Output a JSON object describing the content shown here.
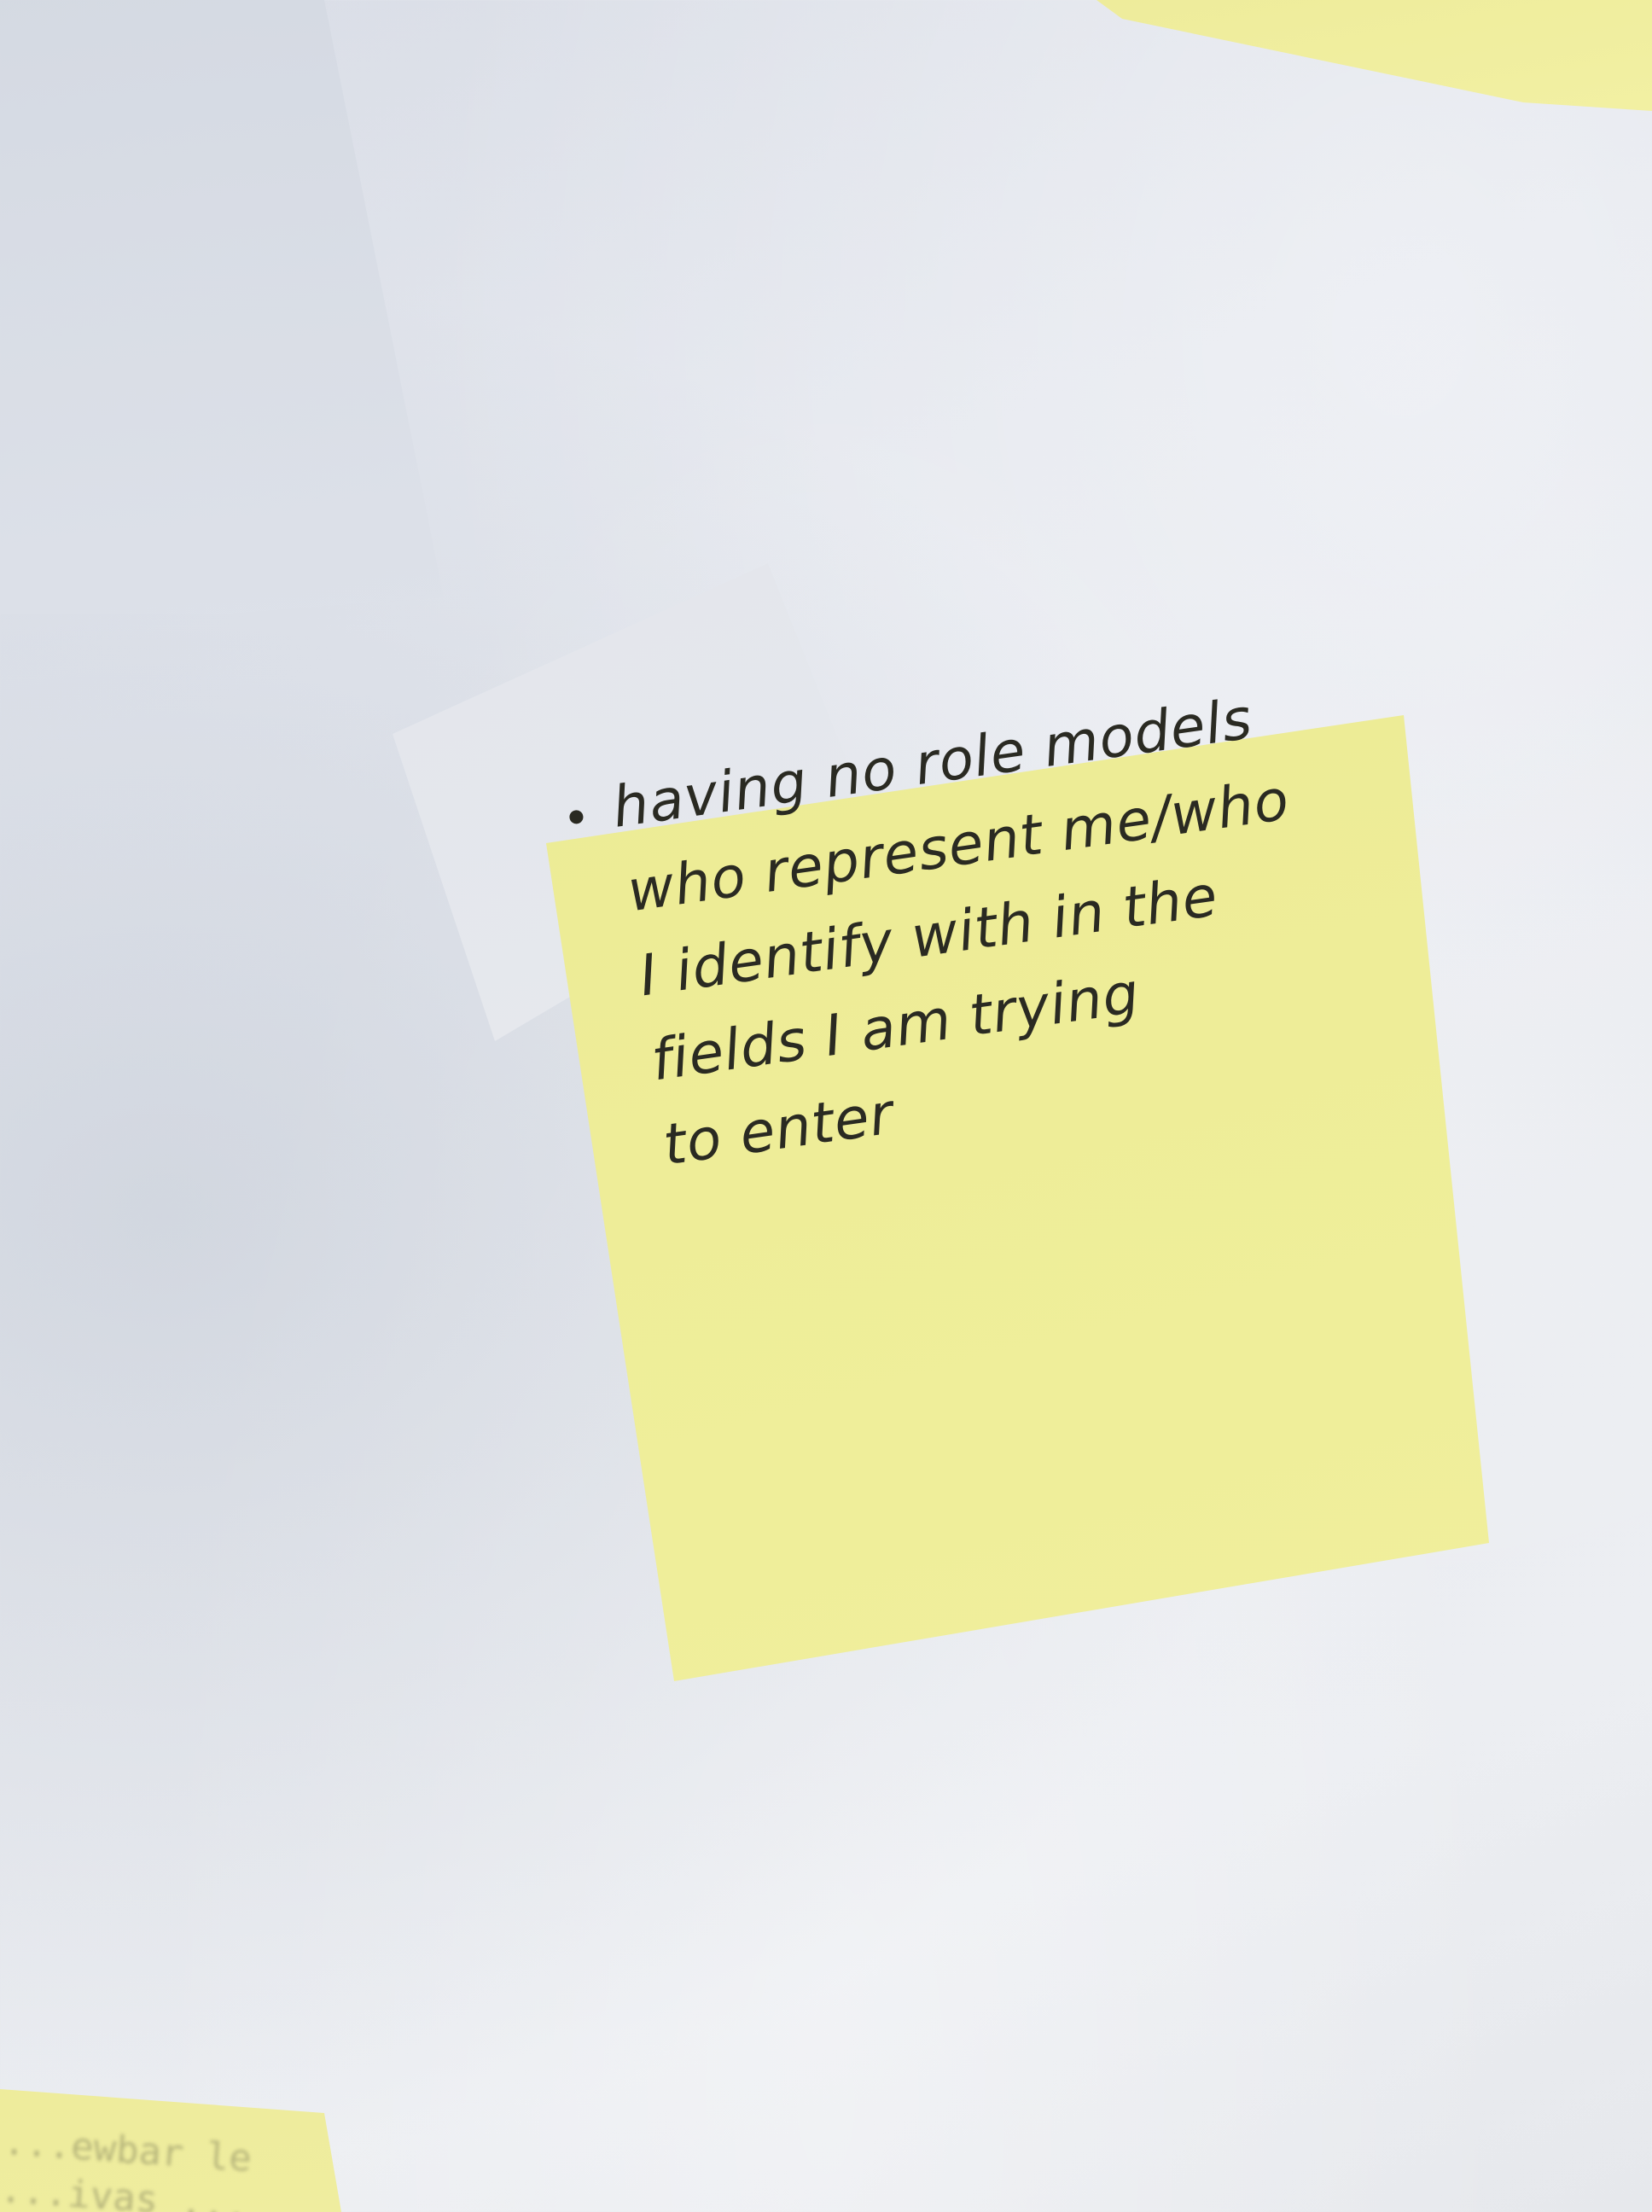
{
  "scene": {
    "wall_color": "#e6e8ee",
    "note_color": "#eeed98",
    "ink_color": "#2a2a22"
  },
  "main_note": {
    "lines": [
      "having no role models",
      "who represent me/who",
      "I identify with in the",
      "fields I am trying",
      "to enter"
    ]
  },
  "bottom_left_note": {
    "lines": [
      "...ewbar le",
      "...ivas ..."
    ]
  }
}
